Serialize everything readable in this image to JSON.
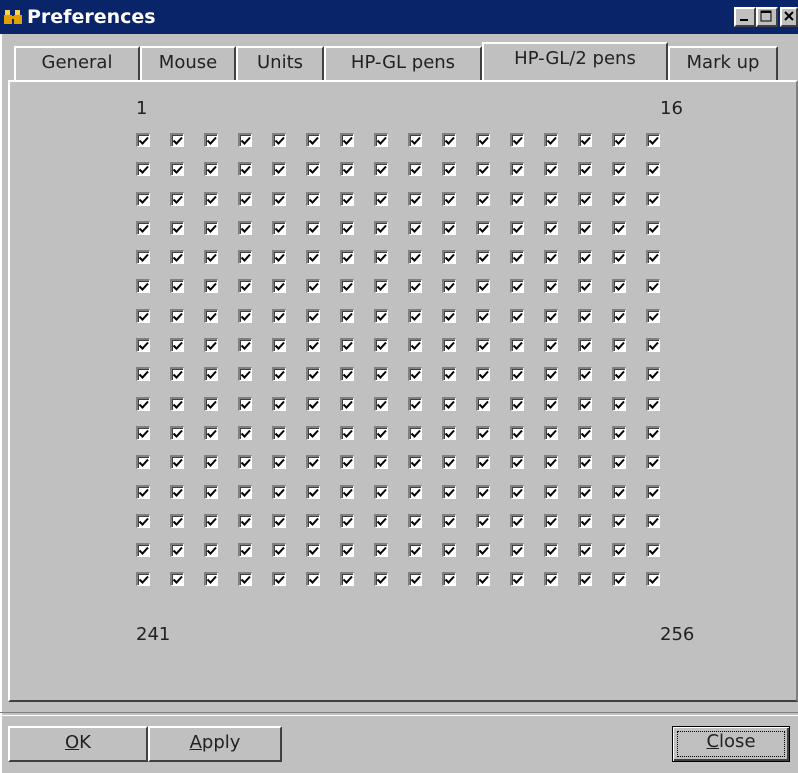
{
  "window": {
    "title": "Preferences"
  },
  "tabs": [
    {
      "label": "General",
      "active": false
    },
    {
      "label": "Mouse",
      "active": false
    },
    {
      "label": "Units",
      "active": false
    },
    {
      "label": "HP-GL pens",
      "active": false
    },
    {
      "label": "HP-GL/2 pens",
      "active": true
    },
    {
      "label": "Mark up",
      "active": false
    }
  ],
  "pens": {
    "label_top_left": "1",
    "label_top_right": "16",
    "label_bottom_left": "241",
    "label_bottom_right": "256",
    "rows": 16,
    "columns": 16,
    "all_checked": true
  },
  "buttons": {
    "ok": {
      "mnemonic": "O",
      "rest": "K"
    },
    "apply": {
      "mnemonic": "A",
      "rest": "pply"
    },
    "close": {
      "mnemonic": "C",
      "rest": "lose"
    }
  },
  "icons": {
    "title": "binoculars-icon",
    "minimize": "minimize-icon",
    "maximize": "maximize-icon",
    "close": "close-icon",
    "check": "checkmark-icon"
  },
  "colors": {
    "titlebar": "#0a246a",
    "face": "#c0c0c0",
    "highlight": "#ffffff",
    "shadow": "#404040"
  }
}
